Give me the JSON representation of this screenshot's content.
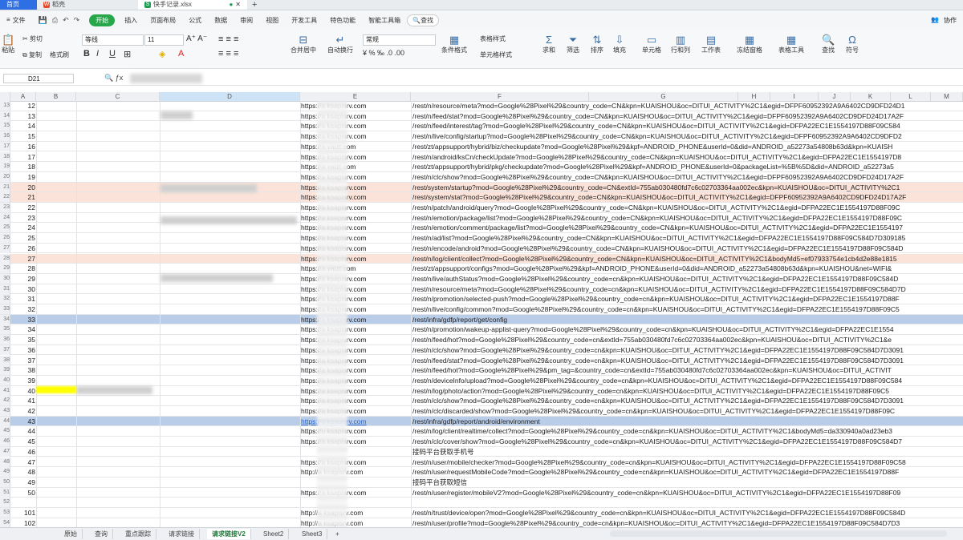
{
  "tabs": {
    "home": "首页",
    "wps": "稻壳",
    "file": "快手记录.xlsx"
  },
  "menu": [
    "文件",
    "开始",
    "插入",
    "页面布局",
    "公式",
    "数据",
    "审阅",
    "视图",
    "开发工具",
    "特色功能",
    "智能工具箱"
  ],
  "menu_search": "查找",
  "collab": "协作",
  "ribbon": {
    "paste": "粘贴",
    "cut": "剪切",
    "copy": "复制",
    "format_painter": "格式刷",
    "font": "等线",
    "size": "11",
    "merge": "合并居中",
    "wrap": "自动换行",
    "numfmt": "常规",
    "condfmt": "条件格式",
    "tablestyle": "表格样式",
    "cellstyle": "单元格样式",
    "sum": "求和",
    "filter": "筛选",
    "sort": "排序",
    "fill": "填充",
    "cell": "单元格",
    "rowcol": "行和列",
    "sheet": "工作表",
    "freeze": "冻结窗格",
    "tabletools": "表格工具",
    "find": "查找",
    "symbol": "符号"
  },
  "namebox": "D21",
  "columns": [
    "A",
    "B",
    "C",
    "D",
    "E",
    "F",
    "G",
    "H",
    "I",
    "J",
    "K",
    "L",
    "M"
  ],
  "rows": [
    {
      "n": "13",
      "b": "12",
      "e": "https://a  ksapisrv.com",
      "f": "/rest/n/resource/meta?mod=Google%28Pixel%29&country_code=CN&kpn=KUAISHOU&oc=DITUI_ACTIVITY%2C1&egid=DFPF60952392A9A6402CD9DFD24D1"
    },
    {
      "n": "14",
      "b": "13",
      "e": "https://a  ksapisrv.com",
      "f": "/rest/n/feed/stat?mod=Google%28Pixel%29&country_code=CN&kpn=KUAISHOU&oc=DITUI_ACTIVITY%2C1&egid=DFPF60952392A9A6402CD9DFD24D17A2F"
    },
    {
      "n": "15",
      "b": "14",
      "e": "https://a  ksapisrv.com",
      "f": "/rest/n/feed/interest/tag?mod=Google%28Pixel%29&country_code=CN&kpn=KUAISHOU&oc=DITUI_ACTIVITY%2C1&egid=DFPA22EC1E1554197D88F09C584"
    },
    {
      "n": "16",
      "b": "15",
      "e": "https://a  ksapisrv.com",
      "f": "/rest/n/live/config/startup?mod=Google%28Pixel%29&country_code=CN&kpn=KUAISHOU&oc=DITUI_ACTIVITY%2C1&egid=DFPF60952392A9A6402CD9DFD2"
    },
    {
      "n": "17",
      "b": "16",
      "e": "https://a  vaizt.com",
      "f": "/rest/zt/appsupport/hybrid/biz/checkupdate?mod=Google%28Pixel%29&kpf=ANDROID_PHONE&userId=0&did=ANDROID_a52273a54808b63d&kpn=KUAISH"
    },
    {
      "n": "18",
      "b": "17",
      "e": "https://a  ksapisrv.com",
      "f": "/rest/n/android/ksCn/checkUpdate?mod=Google%28Pixel%29&country_code=CN&kpn=KUAISHOU&oc=DITUI_ACTIVITY%2C1&egid=DFPA22EC1E1554197D8"
    },
    {
      "n": "19",
      "b": "18",
      "e": "https://a  vaizt.com",
      "f": "/rest/zt/appsupport/hybrid/pkg/checkupdate?mod=Google%28Pixel%29&kpf=ANDROID_PHONE&userId=0&packageList=%5B%5D&did=ANDROID_a52273a5"
    },
    {
      "n": "20",
      "b": "19",
      "e": "https://a  ksapisrv.com",
      "f": "/rest/n/clc/show?mod=Google%28Pixel%29&country_code=CN&kpn=KUAISHOU&oc=DITUI_ACTIVITY%2C1&egid=DFPF60952392A9A6402CD9DFD24D17A2F"
    },
    {
      "n": "21",
      "b": "20",
      "e": "https://a  ksapisrv.com",
      "f": "/rest/system/startup?mod=Google%28Pixel%29&country_code=CN&extId=755ab030480fd7c6c02703364aa002ec&kpn=KUAISHOU&oc=DITUI_ACTIVITY%2C1",
      "hl": "pink"
    },
    {
      "n": "22",
      "b": "21",
      "e": "https://a  ksapisrv.com",
      "f": "/rest/system/stat?mod=Google%28Pixel%29&country_code=CN&kpn=KUAISHOU&oc=DITUI_ACTIVITY%2C1&egid=DFPF60952392A9A6402CD9DFD24D17A2F",
      "hl": "pink"
    },
    {
      "n": "23",
      "b": "22",
      "e": "https://a  ksapisrv.com",
      "f": "/rest/n/patch/android/query?mod=Google%28Pixel%29&country_code=CN&kpn=KUAISHOU&oc=DITUI_ACTIVITY%2C1&egid=DFPA22EC1E1554197D88F09C"
    },
    {
      "n": "24",
      "b": "23",
      "e": "https://a  ksapisrv.com",
      "f": "/rest/n/emotion/package/list?mod=Google%28Pixel%29&country_code=CN&kpn=KUAISHOU&oc=DITUI_ACTIVITY%2C1&egid=DFPA22EC1E1554197D88F09C"
    },
    {
      "n": "25",
      "b": "24",
      "e": "https://a  ksapisrv.com",
      "f": "/rest/n/emotion/comment/package/list?mod=Google%28Pixel%29&country_code=CN&kpn=KUAISHOU&oc=DITUI_ACTIVITY%2C1&egid=DFPA22EC1E1554197"
    },
    {
      "n": "26",
      "b": "25",
      "e": "https://a  ksapisrv.com",
      "f": "/rest/n/ad/list?mod=Google%28Pixel%29&country_code=CN&kpn=KUAISHOU&oc=DITUI_ACTIVITY%2C1&egid=DFPA22EC1E1554197D88F09C584D7D309185"
    },
    {
      "n": "27",
      "b": "26",
      "e": "https://a  ksapisrv.com",
      "f": "/rest/n/encode/android?mod=Google%28Pixel%29&country_code=CN&kpn=KUAISHOU&oc=DITUI_ACTIVITY%2C1&egid=DFPA22EC1E1554197D88F09C584D"
    },
    {
      "n": "28",
      "b": "27",
      "e": "https://a  ksapisrv.com",
      "f": "/rest/n/log/client/collect?mod=Google%28Pixel%29&country_code=CN&kpn=KUAISHOU&oc=DITUI_ACTIVITY%2C1&bodyMd5=ef07933754e1cb4d2e88e1815",
      "hl": "pink"
    },
    {
      "n": "29",
      "b": "28",
      "e": "https://a  vaizt.com",
      "f": "/rest/zt/appsupport/configs?mod=Google%28Pixel%29&kpf=ANDROID_PHONE&userId=0&did=ANDROID_a52273a54808b63d&kpn=KUAISHOU&net=WIFI&"
    },
    {
      "n": "30",
      "b": "29",
      "e": "https://a  ksapisrv.com",
      "f": "/rest/n/live/authStatus?mod=Google%28Pixel%29&country_code=cn&kpn=KUAISHOU&oc=DITUI_ACTIVITY%2C1&egid=DFPA22EC1E1554197D88F09C584D"
    },
    {
      "n": "31",
      "b": "30",
      "e": "https://a  ksapisrv.com",
      "f": "/rest/n/resource/meta?mod=Google%28Pixel%29&country_code=cn&kpn=KUAISHOU&oc=DITUI_ACTIVITY%2C1&egid=DFPA22EC1E1554197D88F09C584D7D"
    },
    {
      "n": "32",
      "b": "31",
      "e": "https://a  ksapisrv.com",
      "f": "/rest/n/promotion/selected-push?mod=Google%28Pixel%29&country_code=cn&kpn=KUAISHOU&oc=DITUI_ACTIVITY%2C1&egid=DFPA22EC1E1554197D88F"
    },
    {
      "n": "33",
      "b": "32",
      "e": "https://a  ksapisrv.com",
      "f": "/rest/n/live/config/common?mod=Google%28Pixel%29&country_code=cn&kpn=KUAISHOU&oc=DITUI_ACTIVITY%2C1&egid=DFPA22EC1E1554197D88F09C5"
    },
    {
      "n": "34",
      "b": "33",
      "e": "https://a  ksapisrv.com",
      "f": "/rest/infra/gdfp/report/get/config",
      "hl": "blue"
    },
    {
      "n": "35",
      "b": "34",
      "e": "https://a  ksapisrv.com",
      "f": "/rest/n/promotion/wakeup-applist-query?mod=Google%28Pixel%29&country_code=cn&kpn=KUAISHOU&oc=DITUI_ACTIVITY%2C1&egid=DFPA22EC1E1554"
    },
    {
      "n": "36",
      "b": "35",
      "e": "https://a  ksapisrv.com",
      "f": "/rest/n/feed/hot?mod=Google%28Pixel%29&country_code=cn&extId=755ab030480fd7c6c02703364aa002ec&kpn=KUAISHOU&oc=DITUI_ACTIVITY%2C1&e"
    },
    {
      "n": "37",
      "b": "36",
      "e": "https://a  ksapisrv.com",
      "f": "/rest/n/clc/show?mod=Google%28Pixel%29&country_code=cn&kpn=KUAISHOU&oc=DITUI_ACTIVITY%2C1&egid=DFPA22EC1E1554197D88F09C584D7D3091"
    },
    {
      "n": "38",
      "b": "37",
      "e": "https://a  ksapisrv.com",
      "f": "/rest/n/feed/stat?mod=Google%28Pixel%29&country_code=cn&kpn=KUAISHOU&oc=DITUI_ACTIVITY%2C1&egid=DFPA22EC1E1554197D88F09C584D7D3091"
    },
    {
      "n": "39",
      "b": "38",
      "e": "https://a  ksapisrv.com",
      "f": "/rest/n/feed/hot?mod=Google%28Pixel%29&pm_tag=&country_code=cn&extId=755ab030480fd7c6c02703364aa002ec&kpn=KUAISHOU&oc=DITUI_ACTIVIT"
    },
    {
      "n": "40",
      "b": "39",
      "e": "https://a  ksapisrv.com",
      "f": "/rest/n/deviceInfo/upload?mod=Google%28Pixel%29&country_code=cn&kpn=KUAISHOU&oc=DITUI_ACTIVITY%2C1&egid=DFPA22EC1E1554197D88F09C584"
    },
    {
      "n": "41",
      "b": "40",
      "e": "https://a  ksapisrv.com",
      "f": "/rest/n/log/photo/action?mod=Google%28Pixel%29&country_code=cn&kpn=KUAISHOU&oc=DITUI_ACTIVITY%2C1&egid=DFPA22EC1E1554197D88F09C5"
    },
    {
      "n": "42",
      "b": "41",
      "e": "https://a  ksapisrv.com",
      "f": "/rest/n/clc/show?mod=Google%28Pixel%29&country_code=cn&kpn=KUAISHOU&oc=DITUI_ACTIVITY%2C1&egid=DFPA22EC1E1554197D88F09C584D7D3091"
    },
    {
      "n": "43",
      "b": "42",
      "e": "https://a  ksapisrv.com",
      "f": "/rest/n/clc/discarded/show?mod=Google%28Pixel%29&country_code=cn&kpn=KUAISHOU&oc=DITUI_ACTIVITY%2C1&egid=DFPA22EC1E1554197D88F09C"
    },
    {
      "n": "44",
      "b": "43",
      "e": "https://g  ksapisrv.com",
      "f": "/rest/infra/gdfp/report/android/environment",
      "hl": "blue",
      "link": true
    },
    {
      "n": "45",
      "b": "44",
      "e": "https://u  ksapisrv.com",
      "f": "/rest/n/log/client/realtime/collect?mod=Google%28Pixel%29&country_code=cn&kpn=KUAISHOU&oc=DITUI_ACTIVITY%2C1&bodyMd5=da330940a0ad23eb3"
    },
    {
      "n": "46",
      "b": "45",
      "e": "https://a  ksapisrv.com",
      "f": "/rest/n/clc/cover/show?mod=Google%28Pixel%29&country_code=cn&kpn=KUAISHOU&oc=DITUI_ACTIVITY%2C1&egid=DFPA22EC1E1554197D88F09C584D7"
    },
    {
      "n": "47",
      "b": "46",
      "e": "",
      "f": "接码平台获取手机号"
    },
    {
      "n": "48",
      "b": "47",
      "e": "https://a  ksapisrv.com",
      "f": "/rest/n/user/mobile/checker?mod=Google%28Pixel%29&country_code=cn&kpn=KUAISHOU&oc=DITUI_ACTIVITY%2C1&egid=DFPA22EC1E1554197D88F09C58"
    },
    {
      "n": "49",
      "b": "48",
      "e": "http://a  ksapisrv.com",
      "f": "/rest/n/user/requestMobileCode?mod=Google%28Pixel%29&country_code=cn&kpn=KUAISHOU&oc=DITUI_ACTIVITY%2C1&egid=DFPA22EC1E1554197D88F"
    },
    {
      "n": "50",
      "b": "49",
      "e": "",
      "f": "接码平台获取短信"
    },
    {
      "n": "51",
      "b": "50",
      "e": "https://a  ksapisrv.com",
      "f": "/rest/n/user/register/mobileV2?mod=Google%28Pixel%29&country_code=cn&kpn=KUAISHOU&oc=DITUI_ACTIVITY%2C1&egid=DFPA22EC1E1554197D88F09"
    },
    {
      "n": "52",
      "b": "",
      "e": "",
      "f": ""
    },
    {
      "n": "53",
      "b": "101",
      "e": "http://a  ksapisrv.com",
      "f": "/rest/n/trust/device/open?mod=Google%28Pixel%29&country_code=cn&kpn=KUAISHOU&oc=DITUI_ACTIVITY%2C1&egid=DFPA22EC1E1554197D88F09C584D"
    },
    {
      "n": "54",
      "b": "102",
      "e": "http://a  ksapisrv.com",
      "f": "/rest/n/user/profile?mod=Google%28Pixel%29&country_code=cn&kpn=KUAISHOU&oc=DITUI_ACTIVITY%2C1&egid=DFPA22EC1E1554197D88F09C584D7D3"
    }
  ],
  "sheets": [
    "原始",
    "查询",
    "重点跟踪",
    "请求链接",
    "请求链接V2",
    "Sheet2",
    "Sheet3"
  ],
  "active_sheet": "请求链接V2"
}
